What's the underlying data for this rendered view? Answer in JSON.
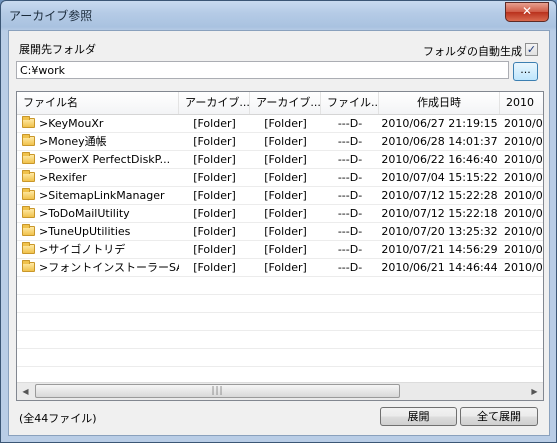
{
  "window": {
    "title": "アーカイブ参照",
    "close_label": "✕"
  },
  "dest": {
    "label": "展開先フォルダ",
    "auto_label": "フォルダの自動生成",
    "auto_checked": "✓",
    "path": "C:¥work",
    "browse_label": "..."
  },
  "list": {
    "columns": [
      "ファイル名",
      "アーカイブ...",
      "アーカイブ...",
      "ファイル...",
      "作成日時",
      "2010"
    ],
    "rows": [
      {
        "name": ">KeyMouXr",
        "a1": "[Folder]",
        "a2": "[Folder]",
        "attr": "---D-",
        "date": "2010/06/27 21:19:15",
        "date2": "2010/0"
      },
      {
        "name": ">Money通帳",
        "a1": "[Folder]",
        "a2": "[Folder]",
        "attr": "---D-",
        "date": "2010/06/28 14:01:37",
        "date2": "2010/0"
      },
      {
        "name": ">PowerX PerfectDiskP...",
        "a1": "[Folder]",
        "a2": "[Folder]",
        "attr": "---D-",
        "date": "2010/06/22 16:46:40",
        "date2": "2010/0"
      },
      {
        "name": ">Rexifer",
        "a1": "[Folder]",
        "a2": "[Folder]",
        "attr": "---D-",
        "date": "2010/07/04 15:15:22",
        "date2": "2010/0"
      },
      {
        "name": ">SitemapLinkManager",
        "a1": "[Folder]",
        "a2": "[Folder]",
        "attr": "---D-",
        "date": "2010/07/12 15:22:28",
        "date2": "2010/0"
      },
      {
        "name": ">ToDoMailUtility",
        "a1": "[Folder]",
        "a2": "[Folder]",
        "attr": "---D-",
        "date": "2010/07/12 15:22:18",
        "date2": "2010/0"
      },
      {
        "name": ">TuneUpUtilities",
        "a1": "[Folder]",
        "a2": "[Folder]",
        "attr": "---D-",
        "date": "2010/07/20 13:25:32",
        "date2": "2010/0"
      },
      {
        "name": ">サイゴノトリデ",
        "a1": "[Folder]",
        "a2": "[Folder]",
        "attr": "---D-",
        "date": "2010/07/21 14:56:29",
        "date2": "2010/0"
      },
      {
        "name": ">フォントインストーラーSA...",
        "a1": "[Folder]",
        "a2": "[Folder]",
        "attr": "---D-",
        "date": "2010/06/21 14:46:44",
        "date2": "2010/0"
      }
    ],
    "scroll_left": "◀",
    "scroll_right": "▶",
    "thumb_grip": "|||"
  },
  "footer": {
    "count": "(全44ファイル)",
    "extract_label": "展開",
    "extract_all_label": "全て展開"
  }
}
